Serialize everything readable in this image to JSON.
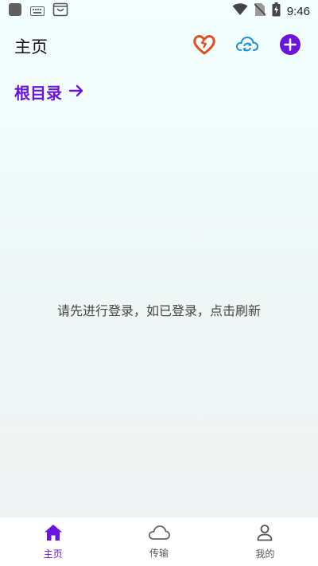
{
  "status_bar": {
    "time": "9:46",
    "icons": [
      "app-notification-icon",
      "keyboard-icon",
      "shopping-bag-icon",
      "wifi-icon",
      "no-sim-icon",
      "battery-charging-icon"
    ]
  },
  "header": {
    "title": "主页",
    "actions": [
      {
        "icon": "heart-icon",
        "color": "#e0501c"
      },
      {
        "icon": "cloud-sync-icon",
        "color": "#1f8fd8"
      },
      {
        "icon": "add-circle-icon",
        "color": "#6a14e0"
      }
    ]
  },
  "breadcrumb": {
    "label": "根目录",
    "icon": "arrow-right-icon",
    "color": "#6a14e0"
  },
  "main": {
    "empty_message": "请先进行登录，如已登录，点击刷新"
  },
  "bottom_nav": {
    "items": [
      {
        "label": "主页",
        "icon": "home-icon",
        "active": true
      },
      {
        "label": "传输",
        "icon": "cloud-icon",
        "active": false
      },
      {
        "label": "我的",
        "icon": "person-icon",
        "active": false
      }
    ],
    "active_color": "#6a14e0"
  }
}
